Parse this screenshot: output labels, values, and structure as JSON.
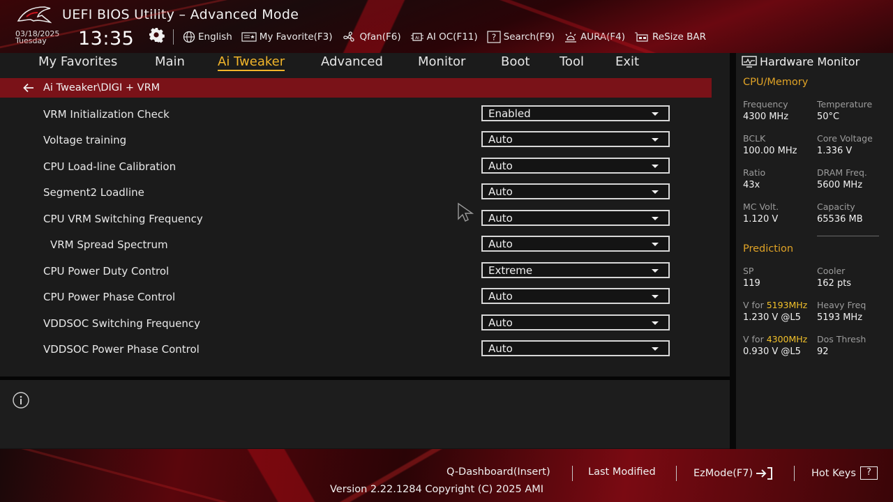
{
  "header": {
    "title": "UEFI BIOS Utility – Advanced Mode",
    "date": "03/18/2025",
    "weekday": "Tuesday",
    "time": "13:35"
  },
  "toolbar": [
    {
      "label": "English",
      "icon": "globe-icon"
    },
    {
      "label": "My Favorite(F3)",
      "icon": "favorite-icon"
    },
    {
      "label": "Qfan(F6)",
      "icon": "fan-icon"
    },
    {
      "label": "AI OC(F11)",
      "icon": "ai-chip-icon"
    },
    {
      "label": "Search(F9)",
      "icon": "search-icon"
    },
    {
      "label": "AURA(F4)",
      "icon": "aura-icon"
    },
    {
      "label": "ReSize BAR",
      "icon": "resize-bar-icon"
    }
  ],
  "tabs": [
    {
      "label": "My Favorites"
    },
    {
      "label": "Main"
    },
    {
      "label": "Ai Tweaker",
      "active": true
    },
    {
      "label": "Advanced"
    },
    {
      "label": "Monitor"
    },
    {
      "label": "Boot"
    },
    {
      "label": "Tool"
    },
    {
      "label": "Exit"
    }
  ],
  "breadcrumb": "Ai Tweaker\\DIGI + VRM",
  "settings": [
    {
      "label": "VRM Initialization Check",
      "value": "Enabled"
    },
    {
      "label": "Voltage training",
      "value": "Auto"
    },
    {
      "label": "CPU Load-line Calibration",
      "value": "Auto"
    },
    {
      "label": "Segment2 Loadline",
      "value": "Auto"
    },
    {
      "label": "CPU VRM Switching Frequency",
      "value": "Auto"
    },
    {
      "label": "VRM Spread Spectrum",
      "value": "Auto"
    },
    {
      "label": "CPU Power Duty Control",
      "value": "Extreme"
    },
    {
      "label": "CPU Power Phase Control",
      "value": "Auto"
    },
    {
      "label": "VDDSOC Switching Frequency",
      "value": "Auto"
    },
    {
      "label": "VDDSOC Power Phase Control",
      "value": "Auto"
    }
  ],
  "hardware_monitor": {
    "title": "Hardware Monitor",
    "cpu_memory": {
      "title": "CPU/Memory",
      "items": [
        {
          "label": "Frequency",
          "value": "4300 MHz"
        },
        {
          "label": "Temperature",
          "value": "50°C"
        },
        {
          "label": "BCLK",
          "value": "100.00 MHz"
        },
        {
          "label": "Core Voltage",
          "value": "1.336 V"
        },
        {
          "label": "Ratio",
          "value": "43x"
        },
        {
          "label": "DRAM Freq.",
          "value": "5600 MHz"
        },
        {
          "label": "MC Volt.",
          "value": "1.120 V"
        },
        {
          "label": "Capacity",
          "value": "65536 MB"
        }
      ]
    },
    "prediction": {
      "title": "Prediction",
      "sp_label": "SP",
      "sp_value": "119",
      "cooler_label": "Cooler",
      "cooler_value": "162 pts",
      "vfor1_prefix": "V for ",
      "vfor1_freq": "5193MHz",
      "vfor1_value": "1.230 V @L5",
      "heavy_label": "Heavy Freq",
      "heavy_value": "5193 MHz",
      "vfor2_prefix": "V for ",
      "vfor2_freq": "4300MHz",
      "vfor2_value": "0.930 V @L5",
      "dos_label": "Dos Thresh",
      "dos_value": "92"
    }
  },
  "footer": {
    "qdashboard": "Q-Dashboard(Insert)",
    "last_modified": "Last Modified",
    "ezmode": "EzMode(F7)",
    "hotkeys": "Hot Keys",
    "hotkeys_key": "?",
    "version": "Version 2.22.1284 Copyright (C) 2025 AMI"
  },
  "colors": {
    "accent": "#f2b52a",
    "breadcrumb_bg": "#7a1218",
    "section_title": "#e0a326"
  }
}
